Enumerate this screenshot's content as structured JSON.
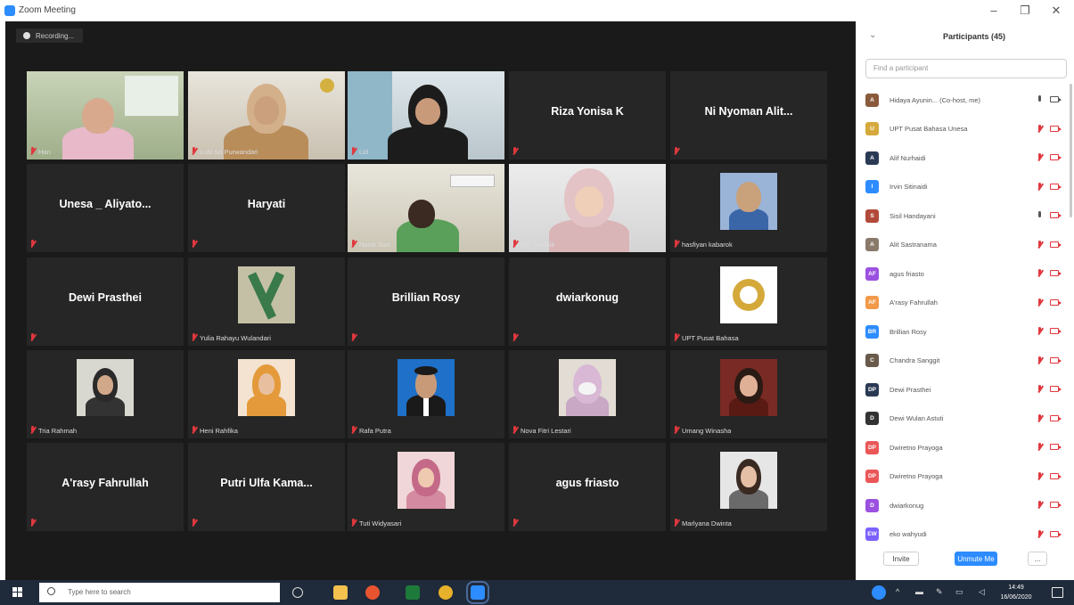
{
  "window": {
    "title": "Zoom Meeting"
  },
  "meeting": {
    "recording_label": "Recording...",
    "tiles": [
      [
        {
          "name_center": "",
          "label": "Han",
          "video": "girl-pink"
        },
        {
          "name_center": "",
          "label": "Lubi Sri Purwandari",
          "video": "woman-hijab"
        },
        {
          "name_center": "",
          "label": "Lid",
          "video": "woman-black-hijab"
        },
        {
          "name_center": "Riza Yonisa K",
          "label": "",
          "video": ""
        },
        {
          "name_center": "Ni Nyoman Alit...",
          "label": "",
          "video": ""
        }
      ],
      [
        {
          "name_center": "Unesa _ Aliyato...",
          "label": "",
          "video": ""
        },
        {
          "name_center": "Haryati",
          "label": "",
          "video": ""
        },
        {
          "name_center": "",
          "label": "Nanik Sart",
          "video": "room-man",
          "active": true
        },
        {
          "name_center": "",
          "label": "NC_Nurlaili",
          "video": "woman-pink-hijab"
        },
        {
          "name_center": "",
          "label": "hasfiyan kabarok",
          "video": "avatar-woman-blue"
        }
      ],
      [
        {
          "name_center": "Dewi Prasthei",
          "label": "",
          "video": ""
        },
        {
          "name_center": "",
          "label": "Yulia Rahayu Wulandari",
          "video": "logo-y"
        },
        {
          "name_center": "Brillian Rosy",
          "label": "",
          "video": ""
        },
        {
          "name_center": "dwiarkonug",
          "label": "",
          "video": ""
        },
        {
          "name_center": "",
          "label": "UPT Pusat Bahasa",
          "video": "logo-seal"
        }
      ],
      [
        {
          "name_center": "",
          "label": "Tria Rahmah",
          "video": "avatar-woman-dark"
        },
        {
          "name_center": "",
          "label": "Heni Rahfika",
          "video": "avatar-woman-orange"
        },
        {
          "name_center": "",
          "label": "Rafa Putra",
          "video": "avatar-man-suit"
        },
        {
          "name_center": "",
          "label": "Nova Fitri Lestari",
          "video": "avatar-woman-mask"
        },
        {
          "name_center": "",
          "label": "Umang Winasha",
          "video": "avatar-woman-red"
        }
      ],
      [
        {
          "name_center": "A'rasy Fahrullah",
          "label": "",
          "video": ""
        },
        {
          "name_center": "Putri Ulfa Kama...",
          "label": "",
          "video": ""
        },
        {
          "name_center": "",
          "label": "Tuti Widyasari",
          "video": "avatar-woman-pink"
        },
        {
          "name_center": "agus friasto",
          "label": "",
          "video": ""
        },
        {
          "name_center": "",
          "label": "Marlyana Dwinta",
          "video": "avatar-woman-light"
        }
      ]
    ]
  },
  "participants": {
    "title": "Participants (45)",
    "search_placeholder": "Find a participant",
    "items": [
      {
        "name": "Hidaya Ayunin... (Co-host, me)",
        "avatar": "A",
        "color": "#8a5a3c",
        "mic": "on",
        "cam": "on"
      },
      {
        "name": "UPT Pusat Bahasa Unesa",
        "avatar": "U",
        "color": "#d6a93c",
        "mic": "off",
        "cam": "off"
      },
      {
        "name": "Alif Nurhaidi",
        "avatar": "A",
        "color": "#2a3a55",
        "mic": "off",
        "cam": "off"
      },
      {
        "name": "Irvin Sitinaidi",
        "avatar": "I",
        "color": "#2d8cff",
        "mic": "off",
        "cam": "off"
      },
      {
        "name": "Sisil Handayani",
        "avatar": "S",
        "color": "#b24a3a",
        "mic": "on",
        "cam": "off"
      },
      {
        "name": "Alit Sastranama",
        "avatar": "A",
        "color": "#8a7a6a",
        "mic": "off",
        "cam": "off"
      },
      {
        "name": "agus friasto",
        "avatar": "AF",
        "color": "#9b51e0",
        "mic": "off",
        "cam": "off"
      },
      {
        "name": "A'rasy Fahrullah",
        "avatar": "AF",
        "color": "#f2994a",
        "mic": "off",
        "cam": "off"
      },
      {
        "name": "Brillian Rosy",
        "avatar": "BR",
        "color": "#2d8cff",
        "mic": "off",
        "cam": "off"
      },
      {
        "name": "Chandra Sanggit",
        "avatar": "C",
        "color": "#6a5a4a",
        "mic": "off",
        "cam": "off"
      },
      {
        "name": "Dewi Prasthei",
        "avatar": "DP",
        "color": "#2a3a55",
        "mic": "off",
        "cam": "off"
      },
      {
        "name": "Dewi Wulan Astuti",
        "avatar": "D",
        "color": "#333333",
        "mic": "off",
        "cam": "off"
      },
      {
        "name": "Dwiretno Prayoga",
        "avatar": "DP",
        "color": "#eb5757",
        "mic": "off",
        "cam": "off"
      },
      {
        "name": "Dwiretno Prayoga",
        "avatar": "DP",
        "color": "#eb5757",
        "mic": "off",
        "cam": "off"
      },
      {
        "name": "dwiarkonug",
        "avatar": "D",
        "color": "#9b51e0",
        "mic": "off",
        "cam": "off"
      },
      {
        "name": "eko wahyudi",
        "avatar": "EW",
        "color": "#7b61ff",
        "mic": "off",
        "cam": "off"
      }
    ],
    "invite_label": "Invite",
    "unmute_label": "Unmute Me",
    "more_label": "..."
  },
  "taskbar": {
    "search_placeholder": "Type here to search",
    "time": "14:49",
    "date": "16/06/2020"
  }
}
